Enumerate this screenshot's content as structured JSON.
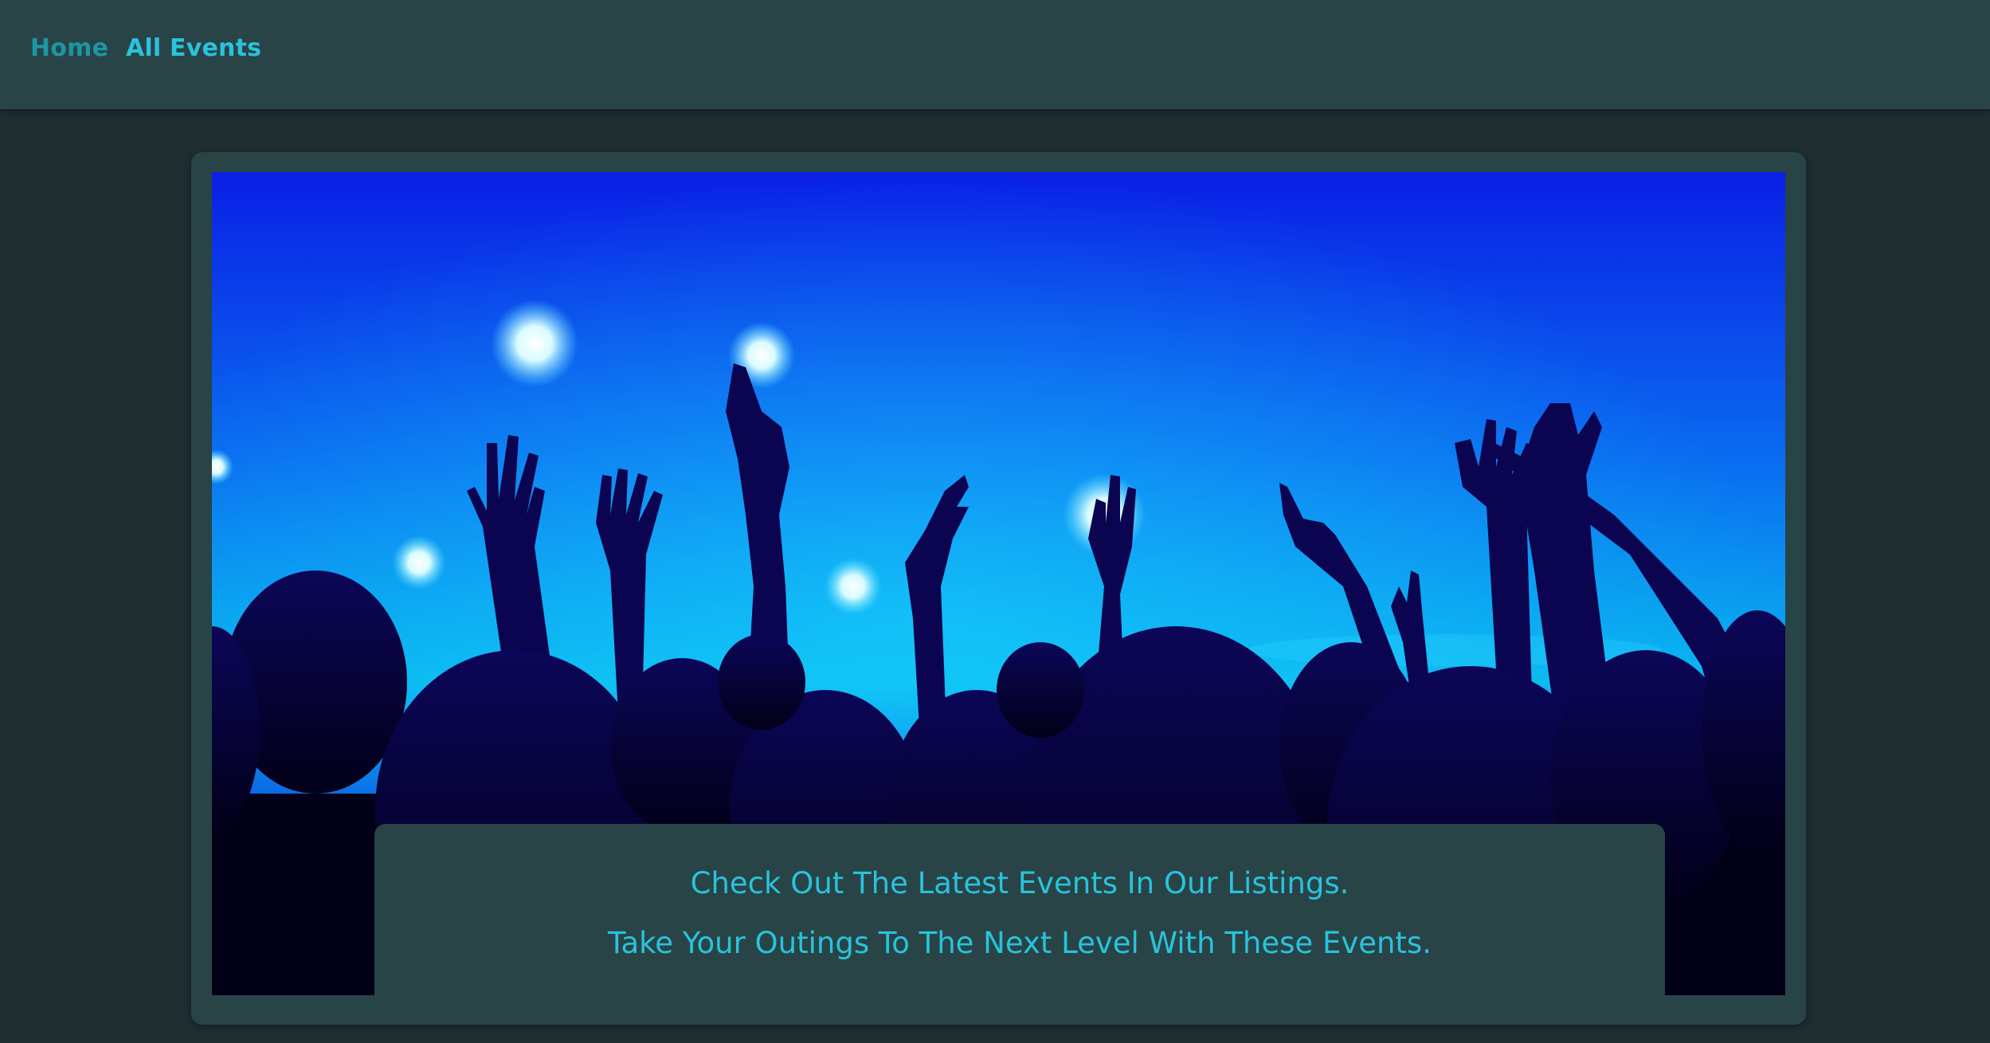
{
  "nav": {
    "home_label": "Home",
    "events_label": "All Events"
  },
  "hero": {
    "image_subject": "concert-crowd-with-raised-hands-blue-stage-lights",
    "caption_line1": "Check Out The Latest Events In Our Listings.",
    "caption_line2": "Take Your Outings To The Next Level With These Events."
  },
  "colors": {
    "page_background": "#1f2e30",
    "surface": "#284447",
    "accent": "#29c3dc",
    "accent_muted": "#1c97a4"
  }
}
